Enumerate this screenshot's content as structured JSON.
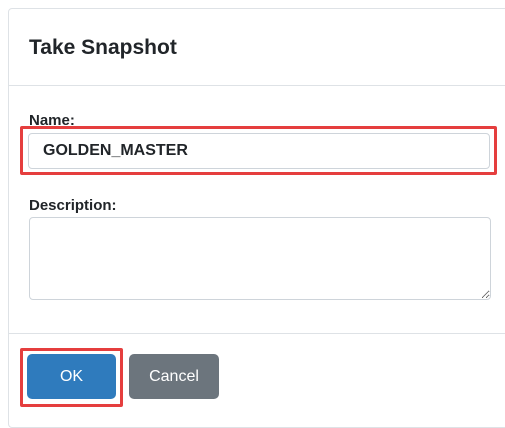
{
  "dialog": {
    "title": "Take Snapshot"
  },
  "form": {
    "name_label": "Name:",
    "name_value": "GOLDEN_MASTER",
    "description_label": "Description:",
    "description_value": ""
  },
  "footer": {
    "ok_label": "OK",
    "cancel_label": "Cancel"
  },
  "colors": {
    "primary": "#2f7bbd",
    "secondary": "#6c757d",
    "highlight": "#e53e3e"
  }
}
